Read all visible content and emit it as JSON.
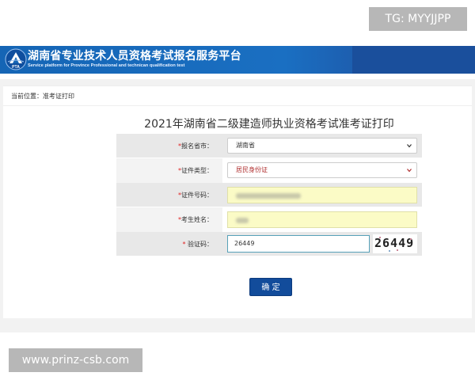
{
  "watermarks": {
    "top": "TG: MYYJJPP",
    "bottom": "www.prinz-csb.com"
  },
  "header": {
    "logo_text": "PTA",
    "title": "湖南省专业技术人员资格考试报名服务平台",
    "subtitle": "Service platform for Province Professional and technican qualification test"
  },
  "breadcrumb": {
    "text": "当前位置：准考证打印"
  },
  "form": {
    "title": "2021年湖南省二级建造师执业资格考试准考证打印",
    "required_mark": "*",
    "fields": {
      "province": {
        "label": "报名省市：",
        "value": "湖南省"
      },
      "id_type": {
        "label": "证件类型：",
        "value": "居民身份证"
      },
      "id_number": {
        "label": "证件号码：",
        "value": ""
      },
      "name": {
        "label": "考生姓名：",
        "value": ""
      },
      "captcha": {
        "label": "验证码：",
        "value": "26449",
        "image_text": "26449"
      }
    },
    "submit_label": "确 定"
  },
  "colors": {
    "banner": "#1a6fc2",
    "button": "#124c9b",
    "required": "#e02020",
    "highlight_input": "#fbfbc6"
  }
}
